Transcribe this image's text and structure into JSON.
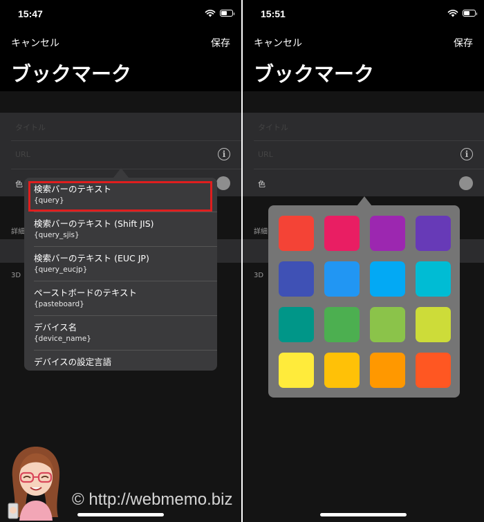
{
  "left": {
    "status_time": "15:47",
    "nav": {
      "cancel": "キャンセル",
      "save": "保存"
    },
    "title": "ブックマーク",
    "form_rows": {
      "name_placeholder": "タイトル",
      "url_placeholder": "URL",
      "color_label": "色"
    },
    "section_detail": "詳細",
    "section_3d": "3D",
    "menu_items": [
      {
        "title": "検索バーのテキスト",
        "token": "{query}"
      },
      {
        "title": "検索バーのテキスト (Shift JIS)",
        "token": "{query_sjis}"
      },
      {
        "title": "検索バーのテキスト (EUC JP)",
        "token": "{query_eucjp}"
      },
      {
        "title": "ペーストボードのテキスト",
        "token": "{pasteboard}"
      },
      {
        "title": "デバイス名",
        "token": "{device_name}"
      },
      {
        "title": "デバイスの設定言語",
        "token": ""
      }
    ],
    "highlighted_index": 0,
    "highlight_color": "#e01e1e"
  },
  "right": {
    "status_time": "15:51",
    "nav": {
      "cancel": "キャンセル",
      "save": "保存"
    },
    "title": "ブックマーク",
    "form_rows": {
      "name_placeholder": "タイトル",
      "url_placeholder": "URL",
      "color_label": "色"
    },
    "section_detail": "詳細",
    "section_3d": "3D",
    "palette_colors": [
      "#f44336",
      "#e91e63",
      "#9c27b0",
      "#673ab7",
      "#3f51b5",
      "#2196f3",
      "#03a9f4",
      "#00bcd4",
      "#009688",
      "#4caf50",
      "#8bc34a",
      "#cddc39",
      "#ffeb3b",
      "#ffc107",
      "#ff9800",
      "#ff5722"
    ]
  },
  "watermark": "© http://webmemo.biz",
  "icons": [
    "wifi-icon",
    "battery-icon",
    "info-icon",
    "color-dot-icon",
    "avatar-illustration"
  ]
}
